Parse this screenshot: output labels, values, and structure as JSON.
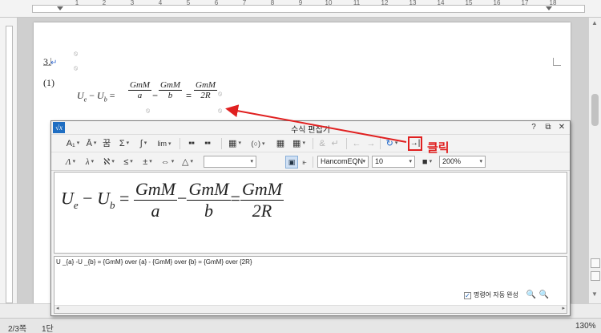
{
  "ruler": {
    "numbers": [
      "1",
      "2",
      "3",
      "4",
      "5",
      "6",
      "7",
      "8",
      "9",
      "10",
      "11",
      "12",
      "13",
      "14",
      "15",
      "16",
      "17",
      "18"
    ]
  },
  "document": {
    "item_number": "3.",
    "eq_label": "(1)",
    "return_mark": "↵",
    "eq": {
      "lhs1": "U",
      "lhs1_sub": "e",
      "minus": "−",
      "lhs2": "U",
      "lhs2_sub": "b",
      "eq": "=",
      "f1_num": "GmM",
      "f1_den": "a",
      "f2_num": "GmM",
      "f2_den": "b",
      "f3_num": "GmM",
      "f3_den": "2R"
    }
  },
  "editor": {
    "title": "수식 편집기",
    "help": "?",
    "restore": "⧉",
    "close": "✕",
    "toolbar1": {
      "sub_sup": "A₁",
      "decor": "Ā",
      "bracket": "꿈",
      "sigma": "Σ",
      "integral": "∫",
      "lim": "lim",
      "m1": "■■",
      "m2": "■■",
      "matrix1": "▦",
      "paren": "(○)",
      "m3": "▦",
      "m4": "▦",
      "undo_left": "←",
      "redo_right": "→",
      "amp": "&",
      "ret": "↵",
      "refresh": "↻",
      "dock_button": "→|"
    },
    "toolbar2": {
      "lambda_upper": "Λ",
      "lambda_lower": "λ",
      "aleph": "ℵ",
      "leq": "≤",
      "pm": "±",
      "iff": "⇔",
      "triangle": "△",
      "blank_select": "",
      "font_select": "HancomEQN",
      "size_select": "10",
      "color": "■",
      "zoom_select": "200%"
    },
    "preview": {
      "lhs1": "U",
      "lhs1_sub": "e",
      "minus": "−",
      "lhs2": "U",
      "lhs2_sub": "b",
      "eq": "=",
      "f1_num": "GmM",
      "f1_den": "a",
      "minus2": "−",
      "f2_num": "GmM",
      "f2_den": "b",
      "eq2": "=",
      "f3_num": "GmM",
      "f3_den": "2R"
    },
    "script": "U _{a} -U _{b} = {GmM} over {a} - {GmM} over {b} = {GmM} over {2R}",
    "auto_complete": {
      "checked": "✓",
      "label": "명령어 자동 완성"
    },
    "zoom_out": "🔍",
    "zoom_in": "🔍"
  },
  "annotation": {
    "label": "클릭",
    "color": "#e02020"
  },
  "status": {
    "page": "2/3쪽",
    "section": "1단",
    "zoom": "130%"
  }
}
